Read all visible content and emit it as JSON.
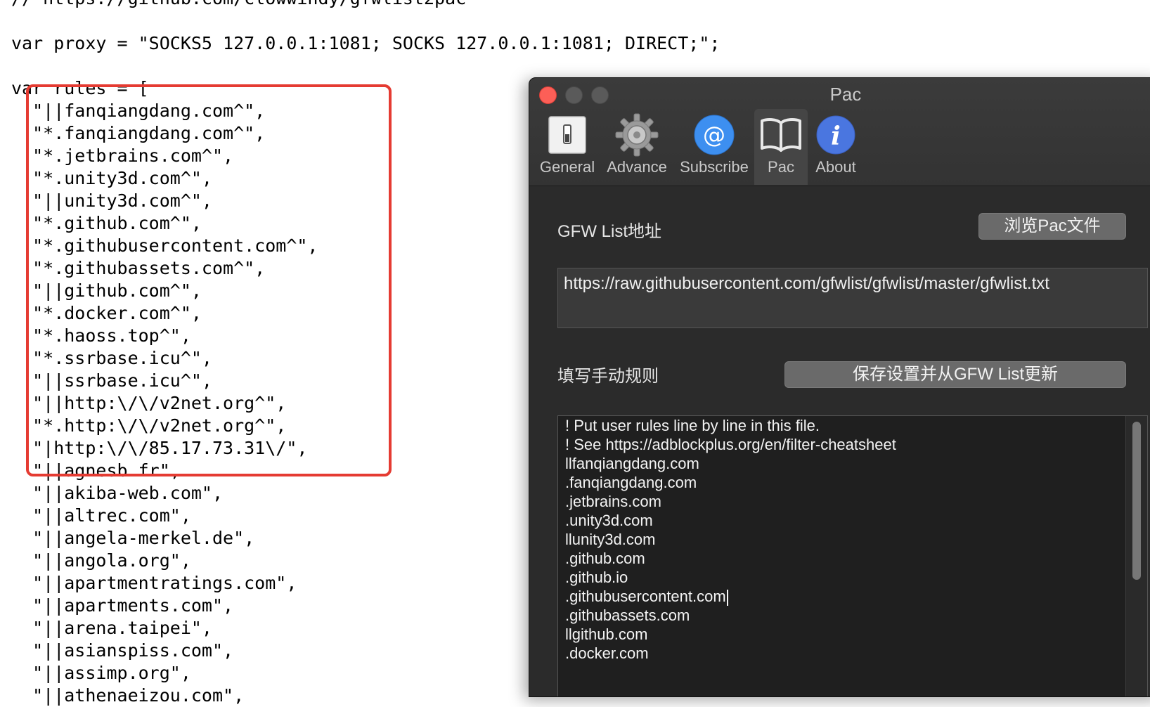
{
  "editor": {
    "lines": [
      "// https://github.com/clowwindy/gfwlist2pac",
      "",
      "var proxy = \"SOCKS5 127.0.0.1:1081; SOCKS 127.0.0.1:1081; DIRECT;\";",
      "",
      "var rules = [",
      "  \"||fanqiangdang.com^\",",
      "  \"*.fanqiangdang.com^\",",
      "  \"*.jetbrains.com^\",",
      "  \"*.unity3d.com^\",",
      "  \"||unity3d.com^\",",
      "  \"*.github.com^\",",
      "  \"*.githubusercontent.com^\",",
      "  \"*.githubassets.com^\",",
      "  \"||github.com^\",",
      "  \"*.docker.com^\",",
      "  \"*.haoss.top^\",",
      "  \"*.ssrbase.icu^\",",
      "  \"||ssrbase.icu^\",",
      "  \"||http:\\/\\/v2net.org^\",",
      "  \"*.http:\\/\\/v2net.org^\",",
      "  \"|http:\\/\\/85.17.73.31\\/\",",
      "  \"||agnesb.fr\",",
      "  \"||akiba-web.com\",",
      "  \"||altrec.com\",",
      "  \"||angela-merkel.de\",",
      "  \"||angola.org\",",
      "  \"||apartmentratings.com\",",
      "  \"||apartments.com\",",
      "  \"||arena.taipei\",",
      "  \"||asianspiss.com\",",
      "  \"||assimp.org\",",
      "  \"||athenaeizou.com\","
    ],
    "highlight_color": "#e53b32"
  },
  "window": {
    "title": "Pac",
    "toolbar": [
      {
        "label": "General",
        "icon": "switch-icon"
      },
      {
        "label": "Advance",
        "icon": "gear-icon"
      },
      {
        "label": "Subscribe",
        "icon": "at-icon"
      },
      {
        "label": "Pac",
        "icon": "book-icon",
        "active": true
      },
      {
        "label": "About",
        "icon": "info-icon"
      }
    ],
    "gfw_label": "GFW List地址",
    "browse_button": "浏览Pac文件",
    "gfw_url": "https://raw.githubusercontent.com/gfwlist/gfwlist/master/gfwlist.txt",
    "manual_label": "填写手动规则",
    "save_button": "保存设置并从GFW List更新",
    "rules": [
      "! Put user rules line by line in this file.",
      "! See https://adblockplus.org/en/filter-cheatsheet",
      "llfanqiangdang.com",
      ".fanqiangdang.com",
      ".jetbrains.com",
      ".unity3d.com",
      "llunity3d.com",
      ".github.com",
      ".github.io",
      ".githubusercontent.com",
      ".githubassets.com",
      "llgithub.com",
      ".docker.com"
    ],
    "colors": {
      "close": "#fc5f57",
      "subscribe_icon": "#3d8ff0",
      "about_icon": "#4a76e0"
    }
  }
}
